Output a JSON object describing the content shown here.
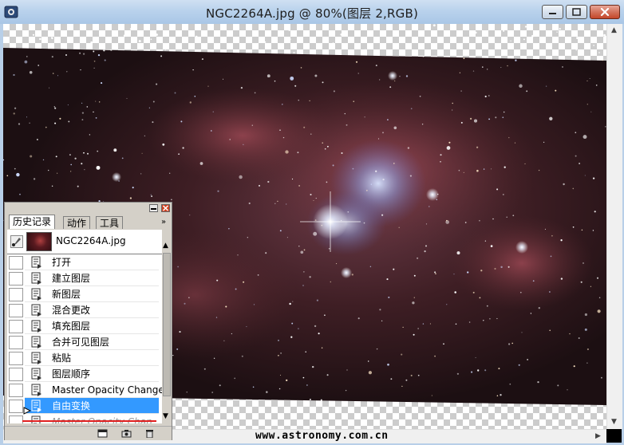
{
  "window": {
    "title": "NGC2264A.jpg @ 80%(图层 2,RGB)",
    "watermark": "www.astronomy.com.cn"
  },
  "history_panel": {
    "tabs": [
      {
        "label": "历史记录",
        "active": true
      },
      {
        "label": "动作",
        "active": false
      },
      {
        "label": "工具",
        "active": false
      }
    ],
    "menu_glyph": "»",
    "snapshot": {
      "label": "NGC2264A.jpg"
    },
    "items": [
      {
        "label": "打开"
      },
      {
        "label": "建立图层"
      },
      {
        "label": "新图层"
      },
      {
        "label": "混合更改"
      },
      {
        "label": "填充图层"
      },
      {
        "label": "合并可见图层"
      },
      {
        "label": "粘贴"
      },
      {
        "label": "图层顺序"
      },
      {
        "label": "Master Opacity Change"
      },
      {
        "label": "自由变换",
        "selected": true
      },
      {
        "label": "Master Opacity Chan...",
        "ghost": true
      }
    ]
  },
  "colors": {
    "selection": "#3399ff",
    "titlebar": "#b9d2ec"
  },
  "icons": {
    "app": "photoshop-app-icon",
    "snapshot_brush": "history-brush-icon",
    "row": "history-state-icon",
    "bottom": [
      "new-document-icon",
      "camera-snapshot-icon",
      "trash-icon"
    ]
  }
}
